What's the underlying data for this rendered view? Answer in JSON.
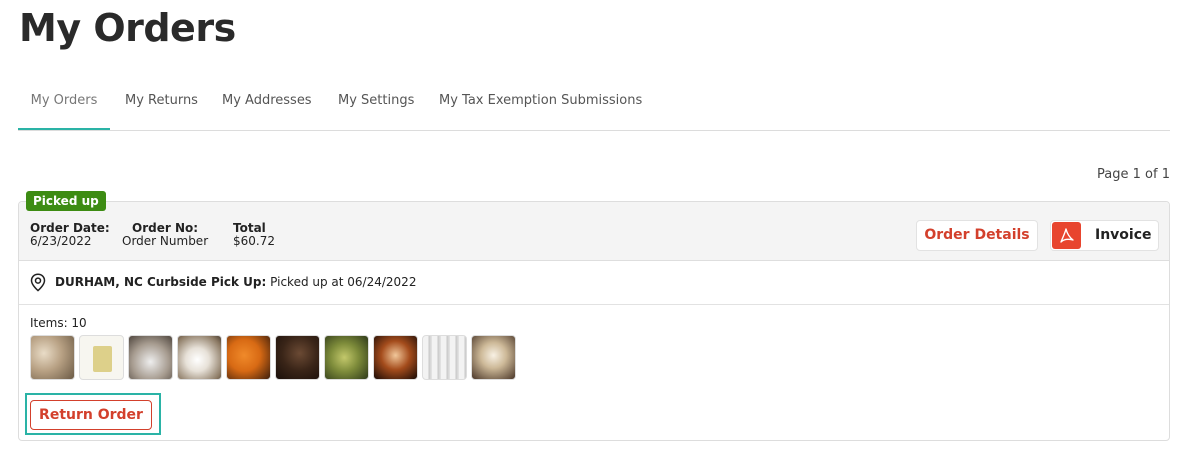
{
  "page": {
    "title": "My Orders"
  },
  "tabs": [
    {
      "label": "My Orders",
      "active": true
    },
    {
      "label": "My Returns"
    },
    {
      "label": "My Addresses"
    },
    {
      "label": "My Settings"
    },
    {
      "label": "My Tax Exemption Submissions"
    }
  ],
  "pagination": {
    "label": "Page 1 of 1"
  },
  "order": {
    "status": "Picked up",
    "status_color": "#3d8c13",
    "date_label": "Order Date:",
    "date_value": "6/23/2022",
    "number_label": "Order No:",
    "number_value": "Order Number",
    "total_label": "Total",
    "total_value": "$60.72",
    "details_button": "Order Details",
    "invoice_button": "Invoice",
    "invoice_icon": "pdf-icon",
    "pickup_location": "DURHAM, NC Curbside Pick Up:",
    "pickup_status": "Picked up at 06/24/2022",
    "pickup_icon": "map-pin-icon",
    "items_label": "Items: 10",
    "item_thumbnails": [
      "product-thumb-pampas-grass",
      "product-thumb-yellow-candle",
      "product-thumb-cotton-branches",
      "product-thumb-marshmallow-mug",
      "product-thumb-persimmon",
      "product-thumb-coffee-beans",
      "product-thumb-pears",
      "product-thumb-roasted-marshmallows",
      "product-thumb-birch-trees",
      "product-thumb-whipped-cream"
    ],
    "return_button": "Return Order"
  },
  "colors": {
    "accent_teal": "#2ab3a6",
    "brand_red": "#d3402c",
    "pdf_red": "#e8452e"
  }
}
